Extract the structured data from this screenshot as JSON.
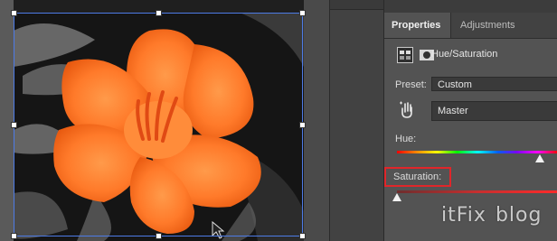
{
  "panel": {
    "tabs": [
      {
        "label": "Properties",
        "active": true
      },
      {
        "label": "Adjustments",
        "active": false
      }
    ],
    "adjustment_title": "Hue/Saturation",
    "icons": [
      "adjustment-layer-icon",
      "mask-icon",
      "targeted-adjustment-hand-icon"
    ],
    "preset": {
      "label": "Preset:",
      "value": "Custom"
    },
    "channel": {
      "value": "Master"
    },
    "hue": {
      "label": "Hue:",
      "value_fraction": 0.89
    },
    "saturation": {
      "label": "Saturation:",
      "value_fraction": 0.0,
      "highlighted": true,
      "highlight_color": "#e0262a"
    }
  },
  "canvas": {
    "subject": "orange-flower-on-grayscale-background",
    "flower_color": "#ff7a2a",
    "selection_color": "#4d7be6"
  },
  "watermark": {
    "part1": "itFix",
    "part2": "blog"
  }
}
